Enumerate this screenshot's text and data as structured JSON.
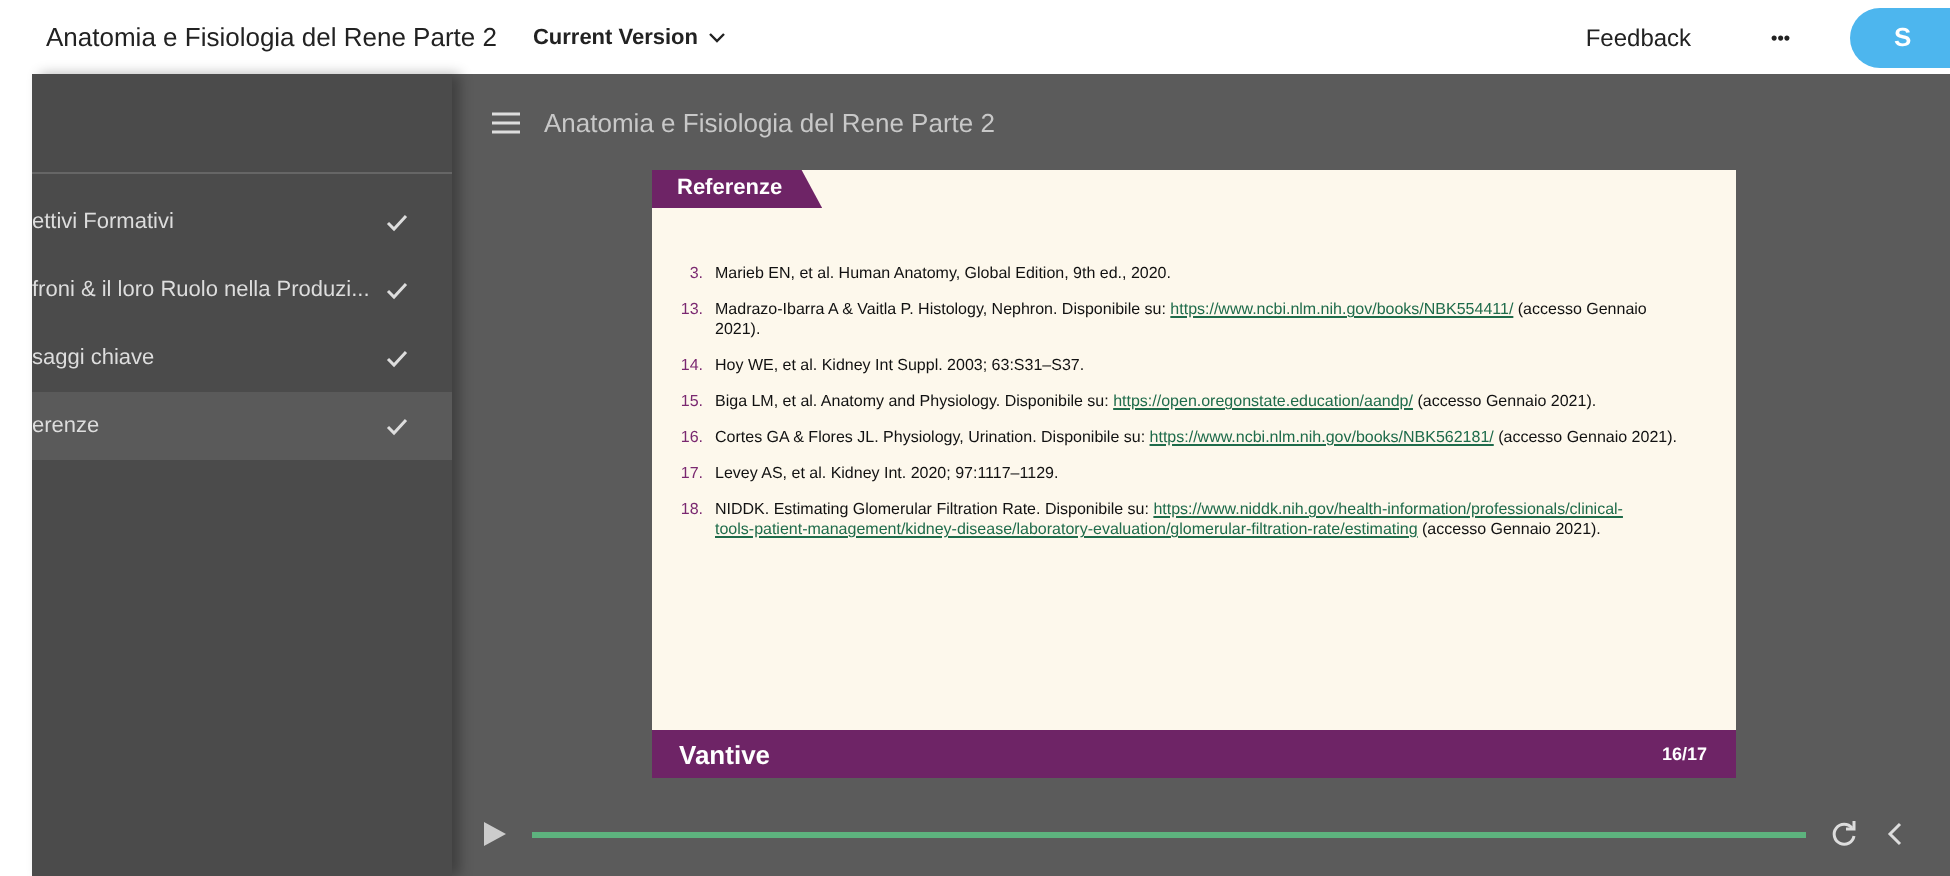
{
  "top_bar": {
    "title": "Anatomia e Fisiologia del Rene Parte 2",
    "version_menu": "Current Version",
    "feedback": "Feedback",
    "more": "•••",
    "action_button": "S"
  },
  "sidebar": {
    "items": [
      {
        "label": "ettivi Formativi",
        "completed": true,
        "selected": false
      },
      {
        "label": "froni & il loro Ruolo nella Produzi...",
        "completed": true,
        "selected": false
      },
      {
        "label": "saggi chiave",
        "completed": true,
        "selected": false
      },
      {
        "label": "erenze",
        "completed": true,
        "selected": true
      }
    ]
  },
  "player": {
    "title": "Anatomia e Fisiologia del Rene Parte 2",
    "slide": {
      "heading": "Referenze",
      "references": [
        {
          "number": "3.",
          "text": "Marieb EN, et al. Human Anatomy, Global Edition, 9th ed., 2020."
        },
        {
          "number": "13.",
          "text": "Madrazo-Ibarra A & Vaitla P. Histology, Nephron. Disponibile su: ",
          "link": "https://www.ncbi.nlm.nih.gov/books/NBK554411/",
          "after": " (accesso Gennaio 2021)."
        },
        {
          "number": "14.",
          "text": "Hoy WE, et al. Kidney Int Suppl. 2003; 63:S31–S37."
        },
        {
          "number": "15.",
          "text": "Biga LM, et al. Anatomy and Physiology. Disponibile su: ",
          "link": "https://open.oregonstate.education/aandp/",
          "after": " (accesso Gennaio 2021)."
        },
        {
          "number": "16.",
          "text": "Cortes GA & Flores JL. Physiology, Urination. Disponibile su: ",
          "link": "https://www.ncbi.nlm.nih.gov/books/NBK562181/",
          "after": " (accesso Gennaio 2021)."
        },
        {
          "number": "17.",
          "text": "Levey AS, et al. Kidney Int. 2020; 97:1117–1129."
        },
        {
          "number": "18.",
          "text": "NIDDK. Estimating Glomerular Filtration Rate. Disponibile su: ",
          "link": "https://www.niddk.nih.gov/health-information/professionals/clinical-",
          "link_continued": "tools-patient-management/kidney-disease/laboratory-evaluation/glomerular-filtration-rate/estimating",
          "after": " (accesso Gennaio 2021)."
        }
      ],
      "brand": "Vantive",
      "page": "16/17"
    },
    "progress": {
      "level": 1
    }
  }
}
